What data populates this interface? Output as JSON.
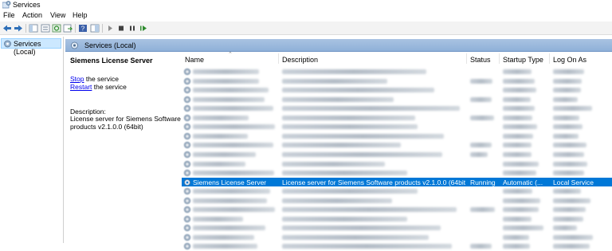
{
  "window": {
    "title": "Services",
    "icon": "services-gear-icon"
  },
  "menu": [
    "File",
    "Action",
    "View",
    "Help"
  ],
  "toolbar": {
    "icons": [
      "back-arrow-icon",
      "forward-arrow-icon",
      "console-tree-icon",
      "properties-icon",
      "refresh-icon",
      "export-list-icon",
      "help-icon",
      "show-hide-icon",
      "start-icon",
      "stop-icon",
      "pause-icon",
      "restart-icon"
    ]
  },
  "tree": {
    "item_label": "Services (Local)"
  },
  "content_header": {
    "label": "Services (Local)"
  },
  "details": {
    "service_name": "Siemens License Server",
    "stop_link": "Stop",
    "stop_suffix": " the service",
    "restart_link": "Restart",
    "restart_suffix": " the service",
    "description_label": "Description:",
    "description_text": "License server for Siemens Software products v2.1.0.0 (64bit)"
  },
  "columns": [
    "Name",
    "Description",
    "Status",
    "Startup Type",
    "Log On As"
  ],
  "selected_row": {
    "name": "Siemens License Server",
    "description": "License server for Siemens Software products v2.1.0.0 (64bit)",
    "status": "Running",
    "startup_type": "Automatic (...",
    "log_on_as": "Local Service"
  },
  "selection_color": "#0078d7",
  "header_color": "#a9c3e2"
}
